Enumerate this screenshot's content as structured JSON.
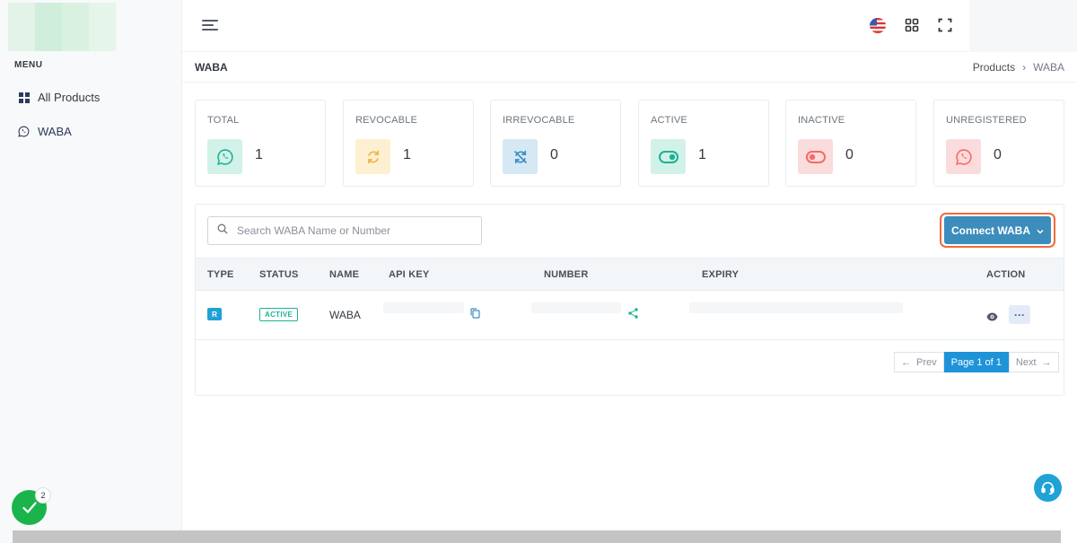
{
  "sidebar": {
    "menu_title": "MENU",
    "items": [
      {
        "label": "All Products",
        "icon": "grid-icon"
      },
      {
        "label": "WABA",
        "icon": "whatsapp-icon"
      }
    ]
  },
  "header": {
    "language": "flag-us-icon"
  },
  "page": {
    "title": "WABA",
    "breadcrumb": [
      "Products",
      "WABA"
    ]
  },
  "stats": [
    {
      "label": "TOTAL",
      "value": "1",
      "icon": "whatsapp-icon",
      "color": "#1bb394"
    },
    {
      "label": "REVOCABLE",
      "value": "1",
      "icon": "refresh-icon",
      "color": "#f1b44c"
    },
    {
      "label": "IRREVOCABLE",
      "value": "0",
      "icon": "no-refresh-icon",
      "color": "#3c8dbc"
    },
    {
      "label": "ACTIVE",
      "value": "1",
      "icon": "toggle-on-icon",
      "color": "#1bb394"
    },
    {
      "label": "INACTIVE",
      "value": "0",
      "icon": "toggle-off-icon",
      "color": "#f46a6a"
    },
    {
      "label": "UNREGISTERED",
      "value": "0",
      "icon": "whatsapp-icon",
      "color": "#f46a6a"
    }
  ],
  "search": {
    "placeholder": "Search WABA Name or Number"
  },
  "connect_button": {
    "label": "Connect WABA"
  },
  "table": {
    "columns": [
      "TYPE",
      "STATUS",
      "NAME",
      "API KEY",
      "NUMBER",
      "EXPIRY",
      "ACTION"
    ],
    "rows": [
      {
        "type": "R",
        "status": "ACTIVE",
        "name": "WABA",
        "action_more": "···"
      }
    ]
  },
  "pagination": {
    "prev": "Prev",
    "current": "Page 1 of 1",
    "next": "Next"
  },
  "notifications": {
    "count": "2"
  },
  "colors": {
    "primary": "#3c8dbc",
    "success": "#1bb394",
    "warning": "#f1b44c",
    "danger": "#f46a6a",
    "highlight": "#f06a3a"
  }
}
